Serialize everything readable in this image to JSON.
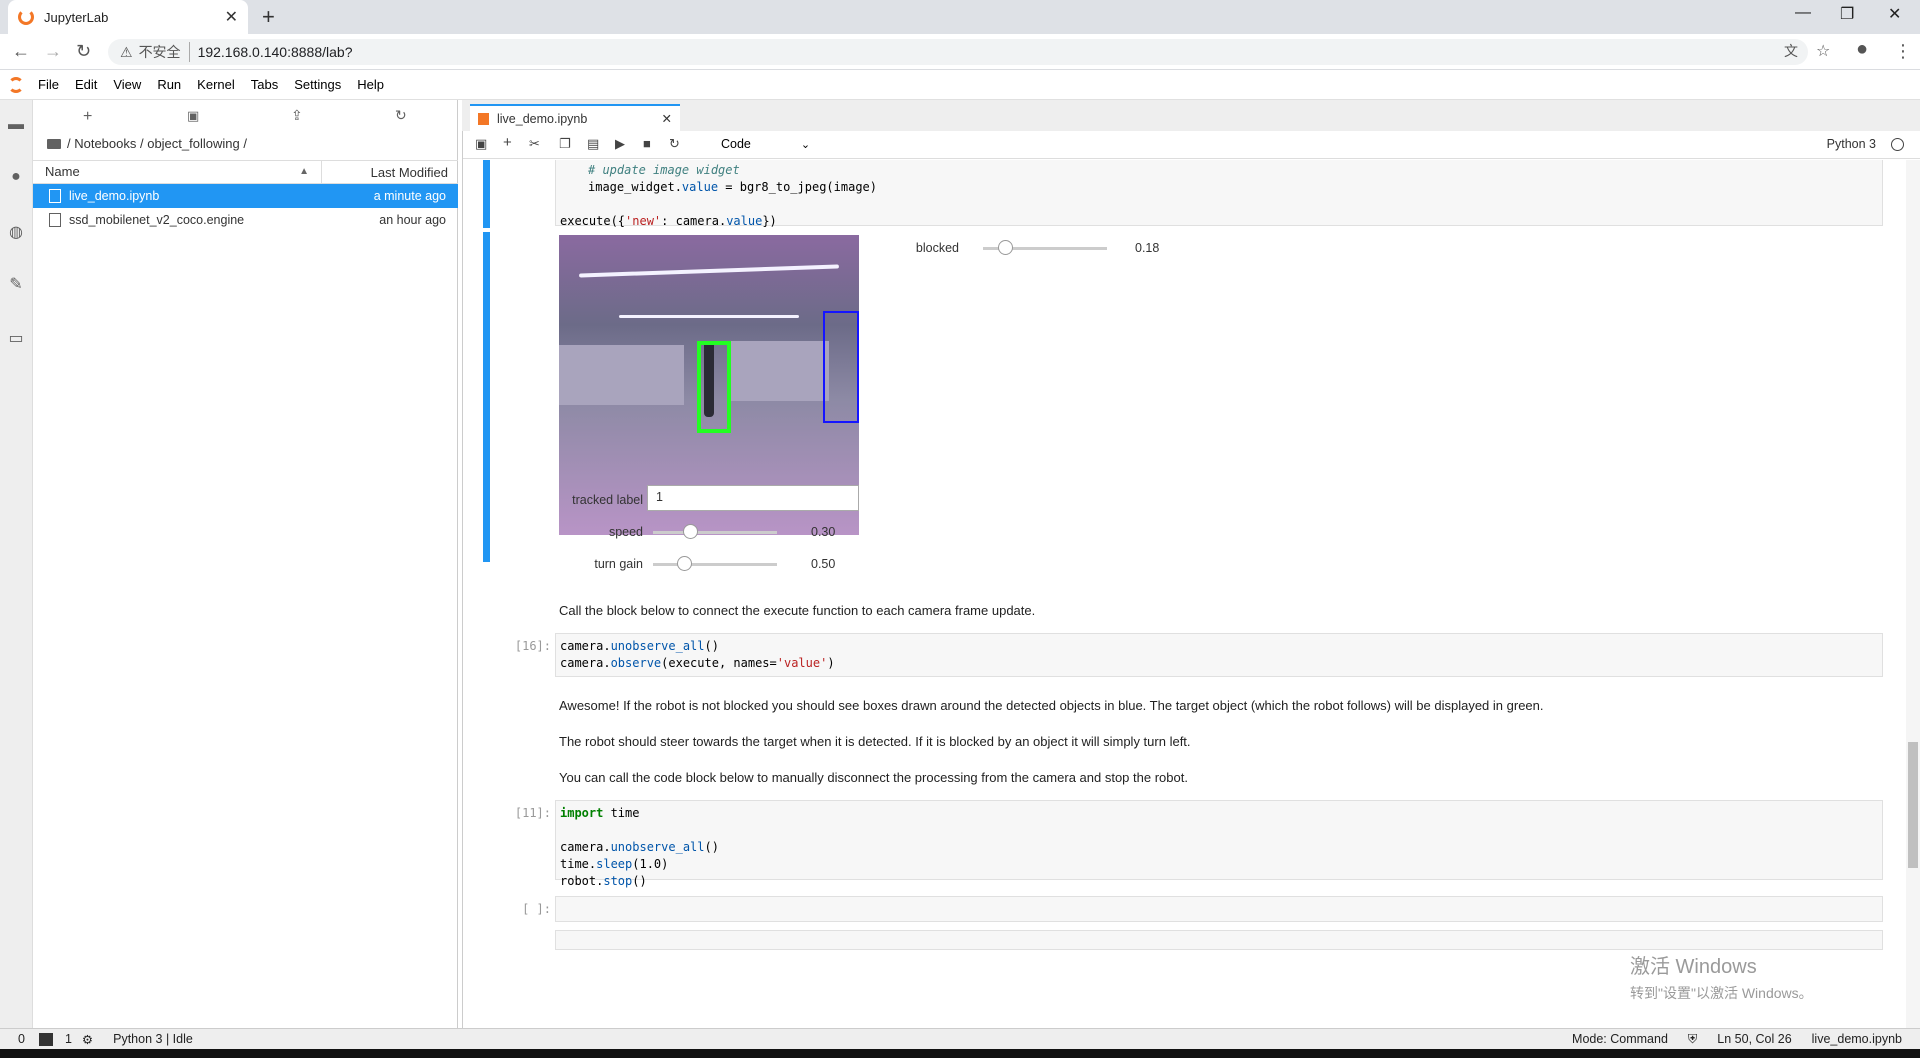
{
  "browser": {
    "tab_title": "JupyterLab",
    "new_tab": "+",
    "security": "不安全",
    "url": "192.168.0.140:8888/lab?"
  },
  "menu": [
    "File",
    "Edit",
    "View",
    "Run",
    "Kernel",
    "Tabs",
    "Settings",
    "Help"
  ],
  "filebrowser": {
    "breadcrumb": "/ Notebooks / object_following /",
    "col_name": "Name",
    "col_modified": "Last Modified",
    "files": [
      {
        "name": "live_demo.ipynb",
        "modified": "a minute ago",
        "selected": true
      },
      {
        "name": "ssd_mobilenet_v2_coco.engine",
        "modified": "an hour ago",
        "selected": false
      }
    ]
  },
  "notebook": {
    "tab_title": "live_demo.ipynb",
    "cell_type": "Code",
    "kernel": "Python 3",
    "code1": {
      "comment": "# update image widget",
      "line2_a": "image_widget.",
      "line2_b": "value",
      "line2_c": " = bgr8_to_jpeg(image)",
      "line3_a": "execute({",
      "line3_b": "'new'",
      "line3_c": ": camera.",
      "line3_d": "value",
      "line3_e": "})"
    },
    "widgets": {
      "blocked_label": "blocked",
      "blocked_value": "0.18",
      "blocked_fraction": 0.18,
      "tracked_label": "tracked label",
      "tracked_value": "1",
      "speed_label": "speed",
      "speed_value": "0.30",
      "speed_fraction": 0.3,
      "turn_label": "turn gain",
      "turn_value": "0.50",
      "turn_fraction": 0.25
    },
    "md1": "Call the block below to connect the execute function to each camera frame update.",
    "cell16": {
      "prompt": "[16]:",
      "l1a": "camera.",
      "l1b": "unobserve_all",
      "l1c": "()",
      "l2a": "camera.",
      "l2b": "observe",
      "l2c": "(execute, names=",
      "l2d": "'value'",
      "l2e": ")"
    },
    "md2": "Awesome! If the robot is not blocked you should see boxes drawn around the detected objects in blue. The target object (which the robot follows) will be displayed in green.",
    "md3": "The robot should steer towards the target when it is detected. If it is blocked by an object it will simply turn left.",
    "md4": "You can call the code block below to manually disconnect the processing from the camera and stop the robot.",
    "cell11": {
      "prompt": "[11]:",
      "kw": "import",
      "mod": " time",
      "l2a": "camera.",
      "l2b": "unobserve_all",
      "l2c": "()",
      "l3a": "time.",
      "l3b": "sleep",
      "l3c": "(1.0)",
      "l4a": "robot.",
      "l4b": "stop",
      "l4c": "()"
    },
    "empty_prompt": "[ ]:"
  },
  "status": {
    "n0": "0",
    "n1": "1",
    "kernel": "Python 3 | Idle",
    "mode": "Mode: Command",
    "pos": "Ln 50, Col 26",
    "file": "live_demo.ipynb"
  },
  "watermark": {
    "line1": "激活 Windows",
    "line2": "转到\"设置\"以激活 Windows。"
  }
}
